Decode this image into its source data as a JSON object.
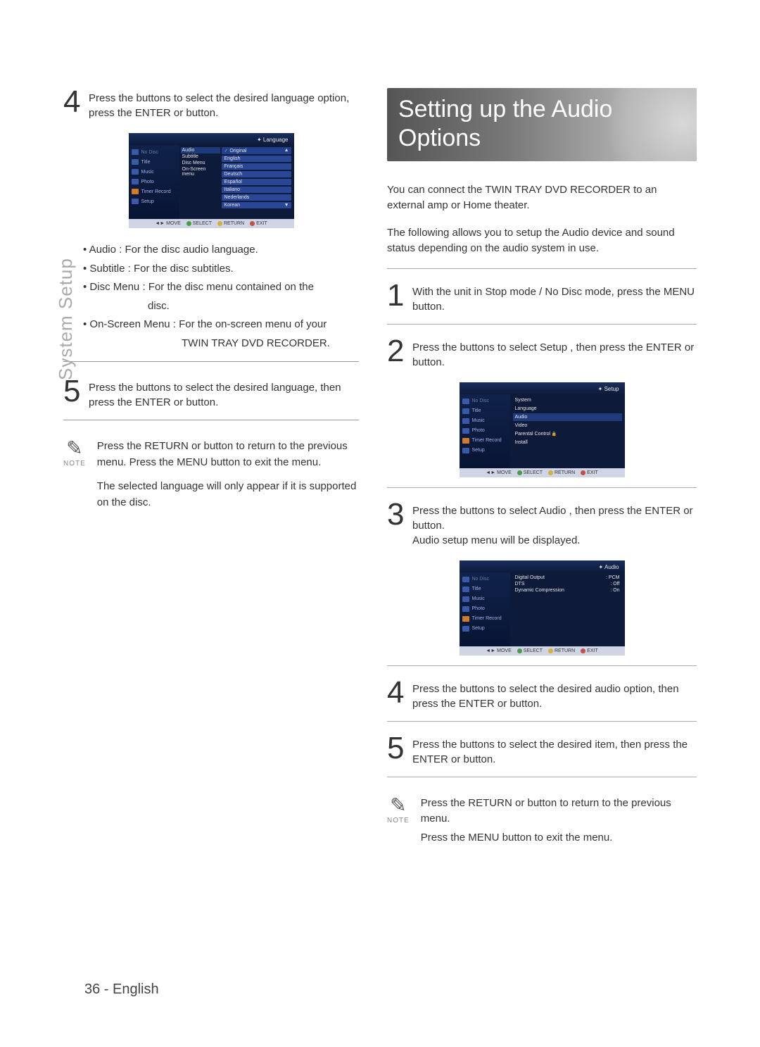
{
  "spine": "System Setup",
  "page_footer": "36 - English",
  "left": {
    "step4": "Press the        buttons to select the desired language option, press the ENTER or      button.",
    "bullets": {
      "b1": "• Audio  : For the disc audio language.",
      "b2": "• Subtitle  : For the disc subtitles.",
      "b3": "• Disc Menu : For the disc menu contained on the",
      "b3b": "disc.",
      "b4": "• On-Screen Menu  : For the on-screen menu of your",
      "b4b": "TWIN TRAY DVD RECORDER."
    },
    "step5": "Press the        buttons to select the desired language, then press the ENTER or      button.",
    "note": {
      "p1": "Press the RETURN or      button to return to the previous menu. Press the MENU button to exit the menu.",
      "p2": "The selected language will only appear if it is supported on the disc."
    }
  },
  "right": {
    "heading": "Setting up the Audio Options",
    "intro1": "You can connect the TWIN TRAY DVD RECORDER to an external amp or Home theater.",
    "intro2": "The following allows you to setup the Audio device and sound status depending on the audio system in use.",
    "step1": "With the unit in Stop mode / No Disc mode, press the MENU button.",
    "step2": "Press the        buttons to select Setup , then press the ENTER or      button.",
    "step3a": "Press the        buttons to select Audio , then press the  ENTER or      button.",
    "step3b": "Audio setup menu will be displayed.",
    "step4": "Press the        buttons to select the desired audio option, then press the ENTER or      button.",
    "step5": "Press the        buttons to select the desired item, then press the ENTER or      button.",
    "note": {
      "p1": "Press the RETURN or       button to return to the previous menu.",
      "p2": "Press the MENU button to exit the menu."
    }
  },
  "note_label": "NOTE",
  "osd": {
    "side": {
      "nodisc": "No Disc",
      "title": "Title",
      "music": "Music",
      "photo": "Photo",
      "timer": "Timer Record",
      "setup": "Setup"
    },
    "foot": {
      "move": "MOVE",
      "select": "SELECT",
      "return": "RETURN",
      "exit": "EXIT"
    },
    "lang_screen": {
      "top": "Language",
      "mid": {
        "audio": "Audio",
        "subtitle": "Subtitle",
        "discmenu": "Disc Menu",
        "osm": "On-Screen menu"
      },
      "list": [
        "Original",
        "English",
        "Français",
        "Deutsch",
        "Español",
        "Italiano",
        "Nederlands",
        "Korean"
      ]
    },
    "setup_screen": {
      "top": "Setup",
      "items": [
        "System",
        "Language",
        "Audio",
        "Video",
        "Parental Control",
        "Install"
      ]
    },
    "audio_screen": {
      "top": "Audio",
      "rows": [
        {
          "k": "Digital Output",
          "v": ": PCM"
        },
        {
          "k": "DTS",
          "v": ": Off"
        },
        {
          "k": "Dynamic Compression",
          "v": ": On"
        }
      ]
    }
  }
}
